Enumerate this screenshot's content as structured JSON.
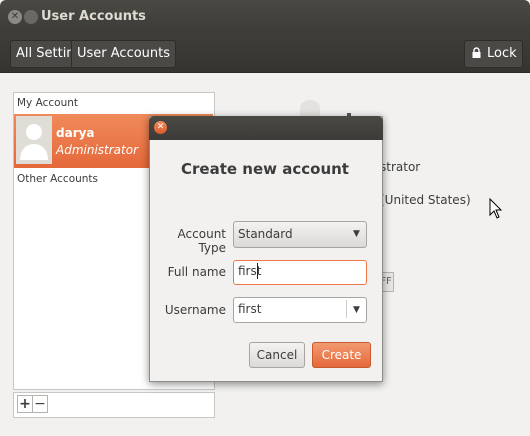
{
  "window": {
    "title": "User Accounts"
  },
  "toolbar": {
    "crumbs": [
      "All Settings",
      "User Accounts"
    ],
    "lock_label": "Lock"
  },
  "accounts": {
    "my_header": "My Account",
    "other_header": "Other Accounts",
    "selected": {
      "name": "darya",
      "role": "Administrator"
    },
    "add_label": "+",
    "remove_label": "−"
  },
  "background": {
    "role_partial": "strator",
    "language_partial": "(United States)",
    "toggle_partial": "FF"
  },
  "dialog": {
    "heading": "Create new account",
    "account_type_label": "Account Type",
    "account_type_value": "Standard",
    "full_name_label": "Full name",
    "full_name_value": "first",
    "username_label": "Username",
    "username_value": "first",
    "cancel_label": "Cancel",
    "create_label": "Create"
  },
  "colors": {
    "accent": "#e5683a",
    "titlebar": "#3c3b37"
  },
  "icons": [
    "close-icon",
    "minimize-icon",
    "lock-icon",
    "avatar-icon",
    "dropdown-arrow-icon",
    "mouse-pointer-icon"
  ]
}
